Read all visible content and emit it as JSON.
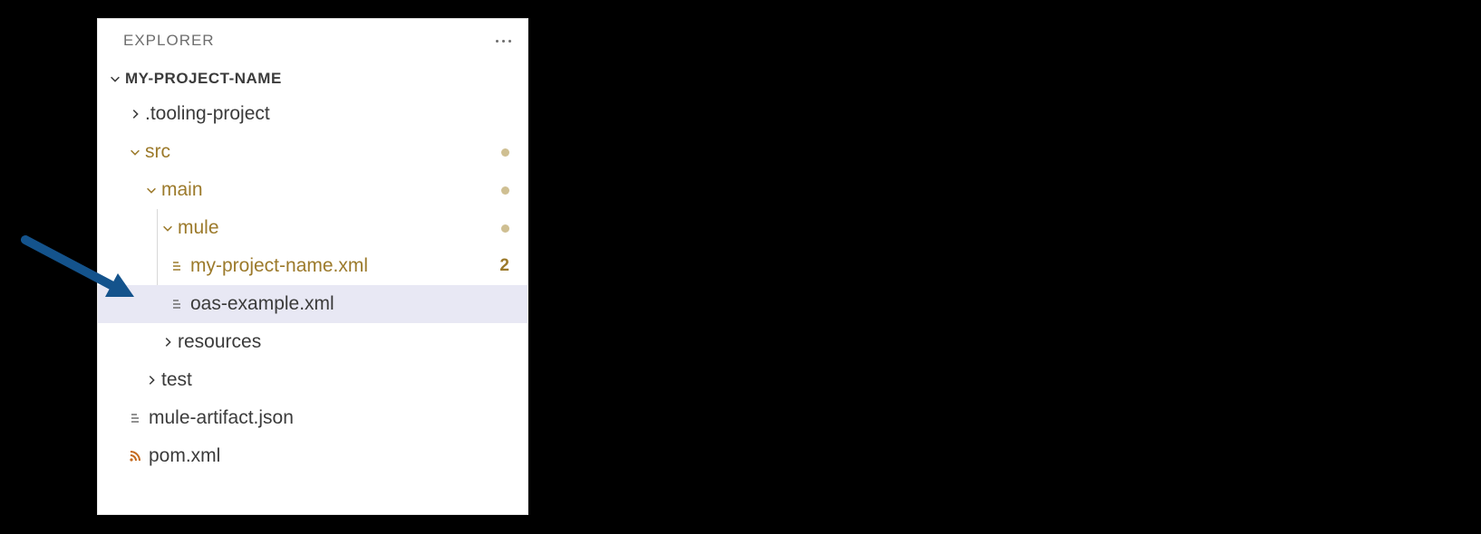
{
  "colors": {
    "git_modified": "#9c7a2b",
    "xml_orange": "#c46a1e",
    "arrow_blue": "#14538c"
  },
  "header": {
    "title": "EXPLORER"
  },
  "repo": {
    "name": "MY-PROJECT-NAME"
  },
  "tree": {
    "tooling_project": {
      "label": ".tooling-project"
    },
    "src": {
      "label": "src"
    },
    "main": {
      "label": "main"
    },
    "mule": {
      "label": "mule"
    },
    "my_project_xml": {
      "label": "my-project-name.xml",
      "badge": "2"
    },
    "oas_example": {
      "label": "oas-example.xml"
    },
    "resources": {
      "label": "resources"
    },
    "test": {
      "label": "test"
    },
    "mule_artifact": {
      "label": "mule-artifact.json"
    },
    "pom": {
      "label": "pom.xml"
    }
  }
}
